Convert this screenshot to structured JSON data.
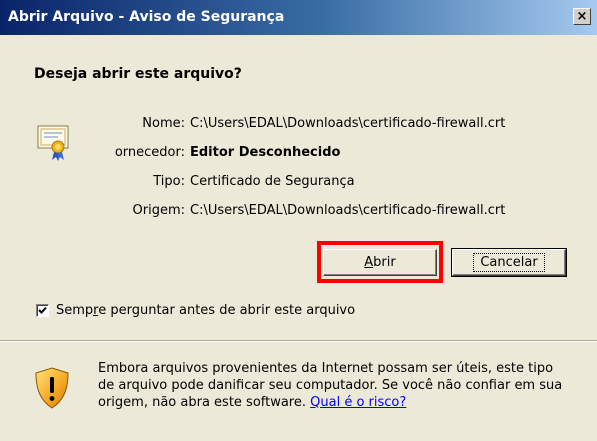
{
  "window": {
    "title": "Abrir Arquivo - Aviso de Segurança",
    "close_glyph": "×"
  },
  "prompt": {
    "question": "Deseja abrir este arquivo?"
  },
  "file_info": {
    "icon": "certificate-icon",
    "rows": [
      {
        "label": "Nome:",
        "value": "C:\\Users\\EDAL\\Downloads\\certificado-firewall.crt"
      },
      {
        "label": "ornecedor:",
        "value": "Editor Desconhecido"
      },
      {
        "label": "Tipo:",
        "value": "Certificado de Segurança"
      },
      {
        "label": "Origem:",
        "value": "C:\\Users\\EDAL\\Downloads\\certificado-firewall.crt"
      }
    ]
  },
  "buttons": {
    "open_access_key": "A",
    "open_rest": "brir",
    "cancel": "Cancelar"
  },
  "checkbox": {
    "checked": true,
    "label_pre": "Semp",
    "label_access_key": "r",
    "label_post": "e perguntar antes de abrir este arquivo"
  },
  "warning": {
    "icon": "shield-warning-icon",
    "line1": "Embora arquivos provenientes da Internet possam ser úteis, este tipo",
    "line2": "de arquivo pode danificar seu computador. Se você não confiar em sua",
    "line3": "origem, não abra este software.",
    "link": "Qual é o risco?"
  },
  "annotation": {
    "highlight_color": "#ff0000"
  }
}
